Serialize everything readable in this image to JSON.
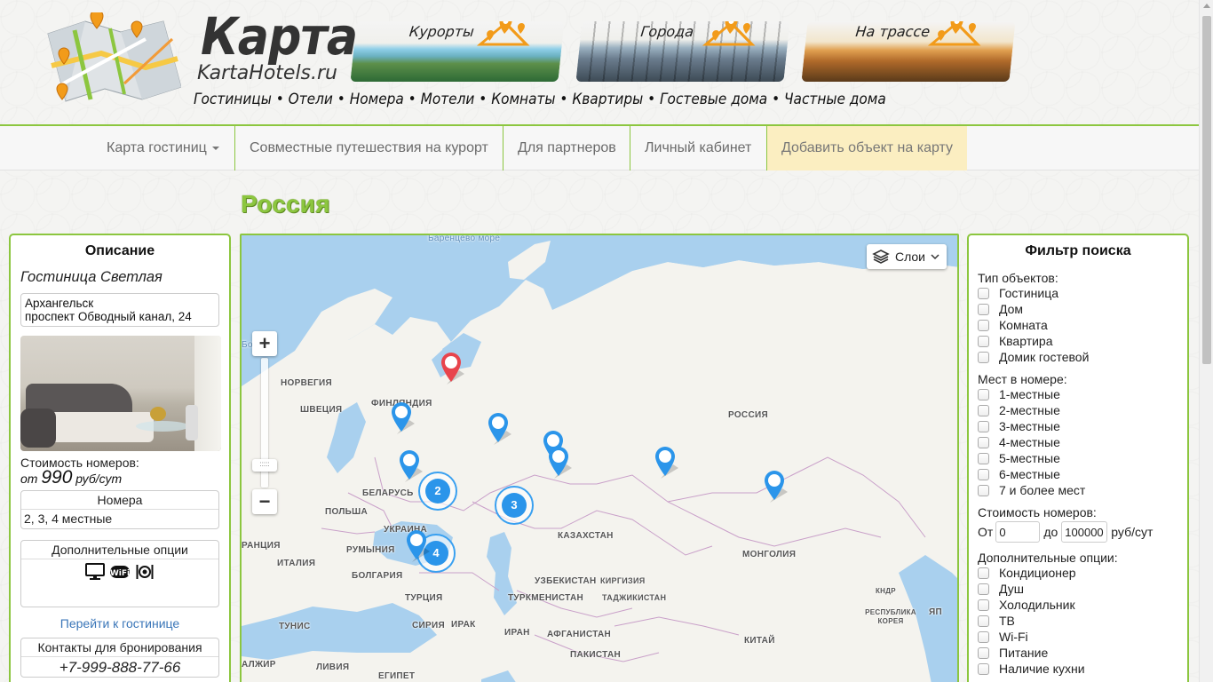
{
  "header": {
    "brand_title": "Карта",
    "brand_url": "KartaHotels.ru",
    "tagline": "Гостиницы • Отели • Номера • Мотели • Комнаты • Квартиры • Гостевые дома • Частные дома",
    "categories": [
      {
        "label": "Курорты",
        "icon": "resort-pin-icon"
      },
      {
        "label": "Города",
        "icon": "city-pin-icon"
      },
      {
        "label": "На трассе",
        "icon": "road-pin-icon"
      }
    ]
  },
  "nav": {
    "items": [
      {
        "label": "Карта гостиниц",
        "has_dropdown": true
      },
      {
        "label": "Совместные путешествия на курорт"
      },
      {
        "label": "Для партнеров"
      },
      {
        "label": "Личный кабинет"
      },
      {
        "label": "Добавить объект на карту",
        "highlight": true
      }
    ]
  },
  "region_title": "Россия",
  "description": {
    "heading": "Описание",
    "hotel_name": "Гостиница Светлая",
    "address_city": "Архангельск",
    "address_street": "проспект Обводный канал, 24",
    "price_label": "Стоимость номеров:",
    "price_prefix": "от",
    "price_value": "990",
    "price_unit": "руб/сут",
    "rooms_heading": "Номера",
    "rooms_value": "2, 3, 4 местные",
    "options_heading": "Дополнительные опции",
    "option_icons": [
      "tv-icon",
      "wifi-icon",
      "dining-icon"
    ],
    "link_label": "Перейти к гостинице",
    "contacts_heading": "Контакты для бронирования",
    "phone": "+7-999-888-77-66"
  },
  "map": {
    "layers_label": "Слои",
    "labels": {
      "barents_sea": "Баренцево море",
      "norway": "НОРВЕГИЯ",
      "sweden": "ШВЕЦИЯ",
      "finland": "ФИНЛЯНДИЯ",
      "russia": "РОССИЯ",
      "belarus": "БЕЛАРУСЬ",
      "poland": "ПОЛЬША",
      "ukraine": "УКРАИНА",
      "romania": "РУМЫНИЯ",
      "bulgaria": "БОЛГАРИЯ",
      "italy": "ИТАЛИЯ",
      "france": "РАНЦИЯ",
      "turkey": "ТУРЦИЯ",
      "tunisia": "ТУНИС",
      "syria": "СИРИЯ",
      "iraq": "ИРАК",
      "iran": "ИРАН",
      "libya": "ЛИВИЯ",
      "egypt": "ЕГИПЕТ",
      "algeria": "АЛЖИР",
      "kazakhstan": "КАЗАХСТАН",
      "uzbekistan": "УЗБЕКИСТАН",
      "kyrgyzstan": "КИРГИЗИЯ",
      "turkmenistan": "ТУРКМЕНИСТАН",
      "tajikistan": "ТАДЖИКИСТАН",
      "afghanistan": "АФГАНИСТАН",
      "pakistan": "ПАКИСТАН",
      "mongolia": "МОНГОЛИЯ",
      "china": "КИТАЙ",
      "korea_north": "КНДР",
      "korea_south": "РЕСПУБЛИКА КОРЕЯ",
      "jpn": "ЯП",
      "sea_edge": "Бо"
    },
    "clusters": [
      "2",
      "3",
      "4"
    ],
    "colors": {
      "marker_blue": "#2b95ea",
      "marker_red": "#e8444c",
      "water": "#a9d0ee",
      "land": "#f4f3ee"
    }
  },
  "filter": {
    "heading": "Фильтр поиска",
    "type_label": "Тип объектов:",
    "types": [
      "Гостиница",
      "Дом",
      "Комната",
      "Квартира",
      "Домик гостевой"
    ],
    "places_label": "Мест в номере:",
    "places": [
      "1-местные",
      "2-местные",
      "3-местные",
      "4-местные",
      "5-местные",
      "6-местные",
      "7 и более мест"
    ],
    "cost_label": "Стоимость номеров:",
    "cost_from_label": "От",
    "cost_from": "0",
    "cost_to_label": "до",
    "cost_to": "100000",
    "cost_unit": "руб/сут",
    "options_label": "Дополнительные опции:",
    "options": [
      "Кондиционер",
      "Душ",
      "Холодильник",
      "ТВ",
      "Wi-Fi",
      "Питание",
      "Наличие кухни"
    ]
  },
  "colors": {
    "accent_green": "#8cc63f",
    "link_blue": "#3a76b8",
    "highlight_bg": "#fbeec1"
  }
}
